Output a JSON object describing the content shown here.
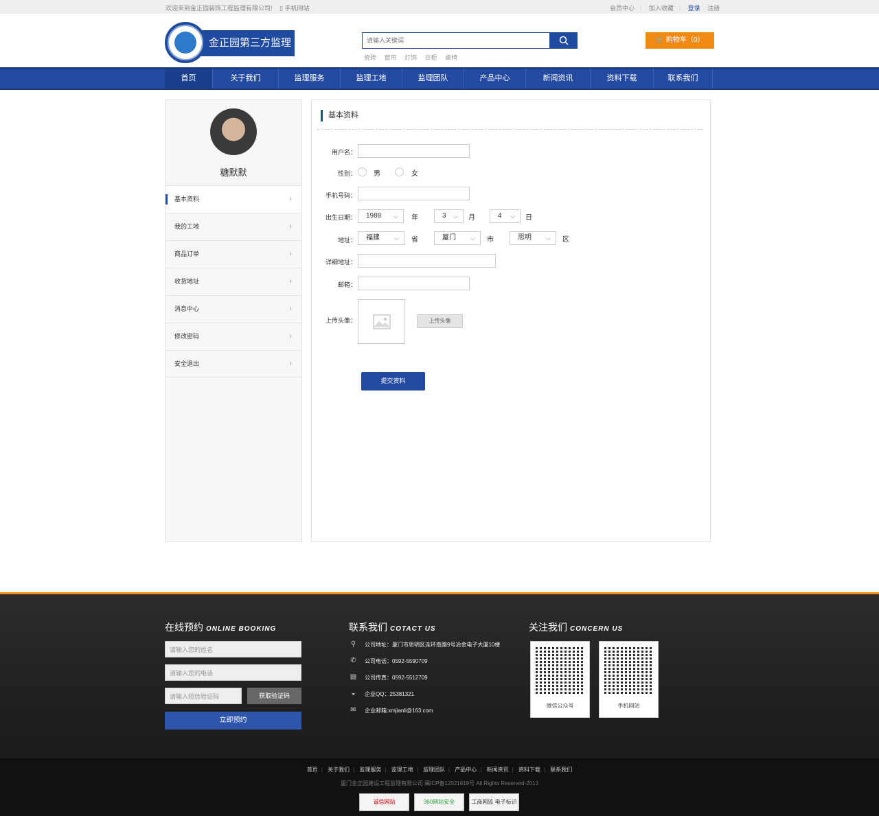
{
  "topbar": {
    "welcome": "欢迎来到金正园装饰工程监理有限公司!",
    "mobile": "手机网站",
    "member": "会员中心",
    "favorite": "加入收藏",
    "login": "登录",
    "register": "注册"
  },
  "logo": {
    "text": "金正园第三方监理"
  },
  "search": {
    "placeholder": "请输入关键词",
    "hotwords": [
      "瓷砖",
      "窗帘",
      "灯饰",
      "衣柜",
      "桌椅"
    ]
  },
  "cart": {
    "label": "购物车（0）"
  },
  "nav": {
    "items": [
      "首页",
      "关于我们",
      "监理服务",
      "监理工地",
      "监理团队",
      "产品中心",
      "新闻资讯",
      "资料下载",
      "联系我们"
    ]
  },
  "sidebar": {
    "username": "糖默默",
    "menu": [
      "基本资料",
      "我的工地",
      "商品订单",
      "收货地址",
      "消息中心",
      "修改密码",
      "安全退出"
    ]
  },
  "form": {
    "title": "基本资料",
    "username_label": "用户名：",
    "gender_label": "性别：",
    "male": "男",
    "female": "女",
    "phone_label": "手机号码：",
    "birth_label": "出生日期：",
    "year": "1988",
    "year_unit": "年",
    "month": "3",
    "month_unit": "月",
    "day": "4",
    "day_unit": "日",
    "address_label": "地址：",
    "province": "福建",
    "province_unit": "省",
    "city": "厦门",
    "city_unit": "市",
    "district": "思明",
    "district_unit": "区",
    "detail_label": "详细地址：",
    "email_label": "邮箱：",
    "avatar_label": "上传头像：",
    "upload_btn": "上传头像",
    "submit": "提交资料"
  },
  "footer": {
    "booking": {
      "title": "在线预约",
      "title_en": "ONLINE BOOKING",
      "name_placeholder": "请输入您的姓名",
      "phone_placeholder": "请输入您的电话",
      "code_placeholder": "请输入短信验证码",
      "code_btn": "获取验证码",
      "submit": "立即预约"
    },
    "contact": {
      "title": "联系我们",
      "title_en": "COTACT US",
      "address": "公司地址：厦门市思明区连环南路9号冶金电子大厦10楼",
      "phone": "公司电话：0592-5590709",
      "fax": "公司传真：0592-5512709",
      "qq": "企业QQ：25381321",
      "email": "企业邮箱:xmjianli@163.com"
    },
    "follow": {
      "title": "关注我们",
      "title_en": "CONCERN US",
      "wechat": "微信公众号",
      "mobile": "手机网站"
    },
    "links": [
      "首页",
      "关于我们",
      "监理服务",
      "监理工地",
      "监理团队",
      "产品中心",
      "新闻资讯",
      "资料下载",
      "联系我们"
    ],
    "copyright": "厦门金正园建设工程监理有限公司  闽ICP备12021619号 All Rights Reserved-2013",
    "badges": [
      "诚信网站",
      "360网站安全",
      "工商网监 电子标识"
    ]
  }
}
